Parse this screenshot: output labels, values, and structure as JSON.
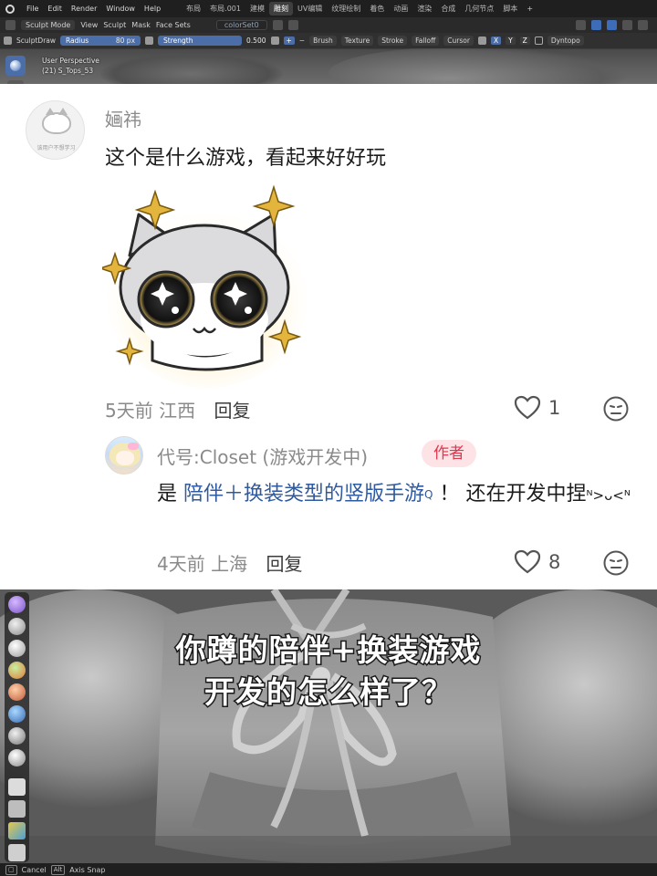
{
  "blender": {
    "menu": [
      "File",
      "Edit",
      "Render",
      "Window",
      "Help"
    ],
    "workspaces": [
      "布局",
      "布局.001",
      "建模",
      "雕刻",
      "UV编辑",
      "纹理绘制",
      "着色",
      "动画",
      "渲染",
      "合成",
      "几何节点",
      "脚本"
    ],
    "active_workspace": "雕刻",
    "add_tab": "+",
    "mode": "Sculpt Mode",
    "header_menus": [
      "View",
      "Sculpt",
      "Mask",
      "Face Sets"
    ],
    "object_name": "colorSet0",
    "tool": {
      "brush_name": "SculptDraw",
      "radius_label": "Radius",
      "radius_value": "80 px",
      "strength_label": "Strength",
      "strength_value": "0.500",
      "plus": "+",
      "minus": "−",
      "dropdowns": [
        "Brush",
        "Texture",
        "Stroke",
        "Falloff",
        "Cursor"
      ],
      "axes": [
        "X",
        "Y",
        "Z"
      ],
      "dyntopo": "Dyntopo"
    },
    "viewport": {
      "view_label": "User Perspective",
      "object_label": "(21) S_Tops_53"
    },
    "status": {
      "cancel": "Cancel",
      "alt_key": "Alt",
      "axis_snap": "Axis Snap"
    }
  },
  "comments": [
    {
      "avatar_caption": "该用户不想学习",
      "username": "婳祎",
      "text": "这个是什么游戏，看起来好好玩",
      "time": "5天前",
      "location": "江西",
      "reply_label": "回复",
      "likes": "1"
    },
    {
      "username": "代号:Closet (游戏开发中)",
      "badge": "作者",
      "text_prefix": "是 ",
      "link_text": "陪伴＋换装类型的竖版手游",
      "link_mark": "Q",
      "text_suffix": "！ 还在开发中捏",
      "kaomoji": "ᴺ>ᴗ<ᴺ",
      "time": "4天前",
      "location": "上海",
      "reply_label": "回复",
      "likes": "8"
    }
  ],
  "subtitle": {
    "line1": "你蹲的陪伴+换装游戏",
    "line2": "开发的怎么样了？"
  },
  "colors": {
    "blender_accent": "#4b6ea8",
    "author_badge_bg": "#fde3e6",
    "author_badge_text": "#e0374f",
    "link": "#2f5a9f"
  },
  "icons": [
    "heart-icon",
    "meh-face-icon",
    "sparkle-icon"
  ]
}
